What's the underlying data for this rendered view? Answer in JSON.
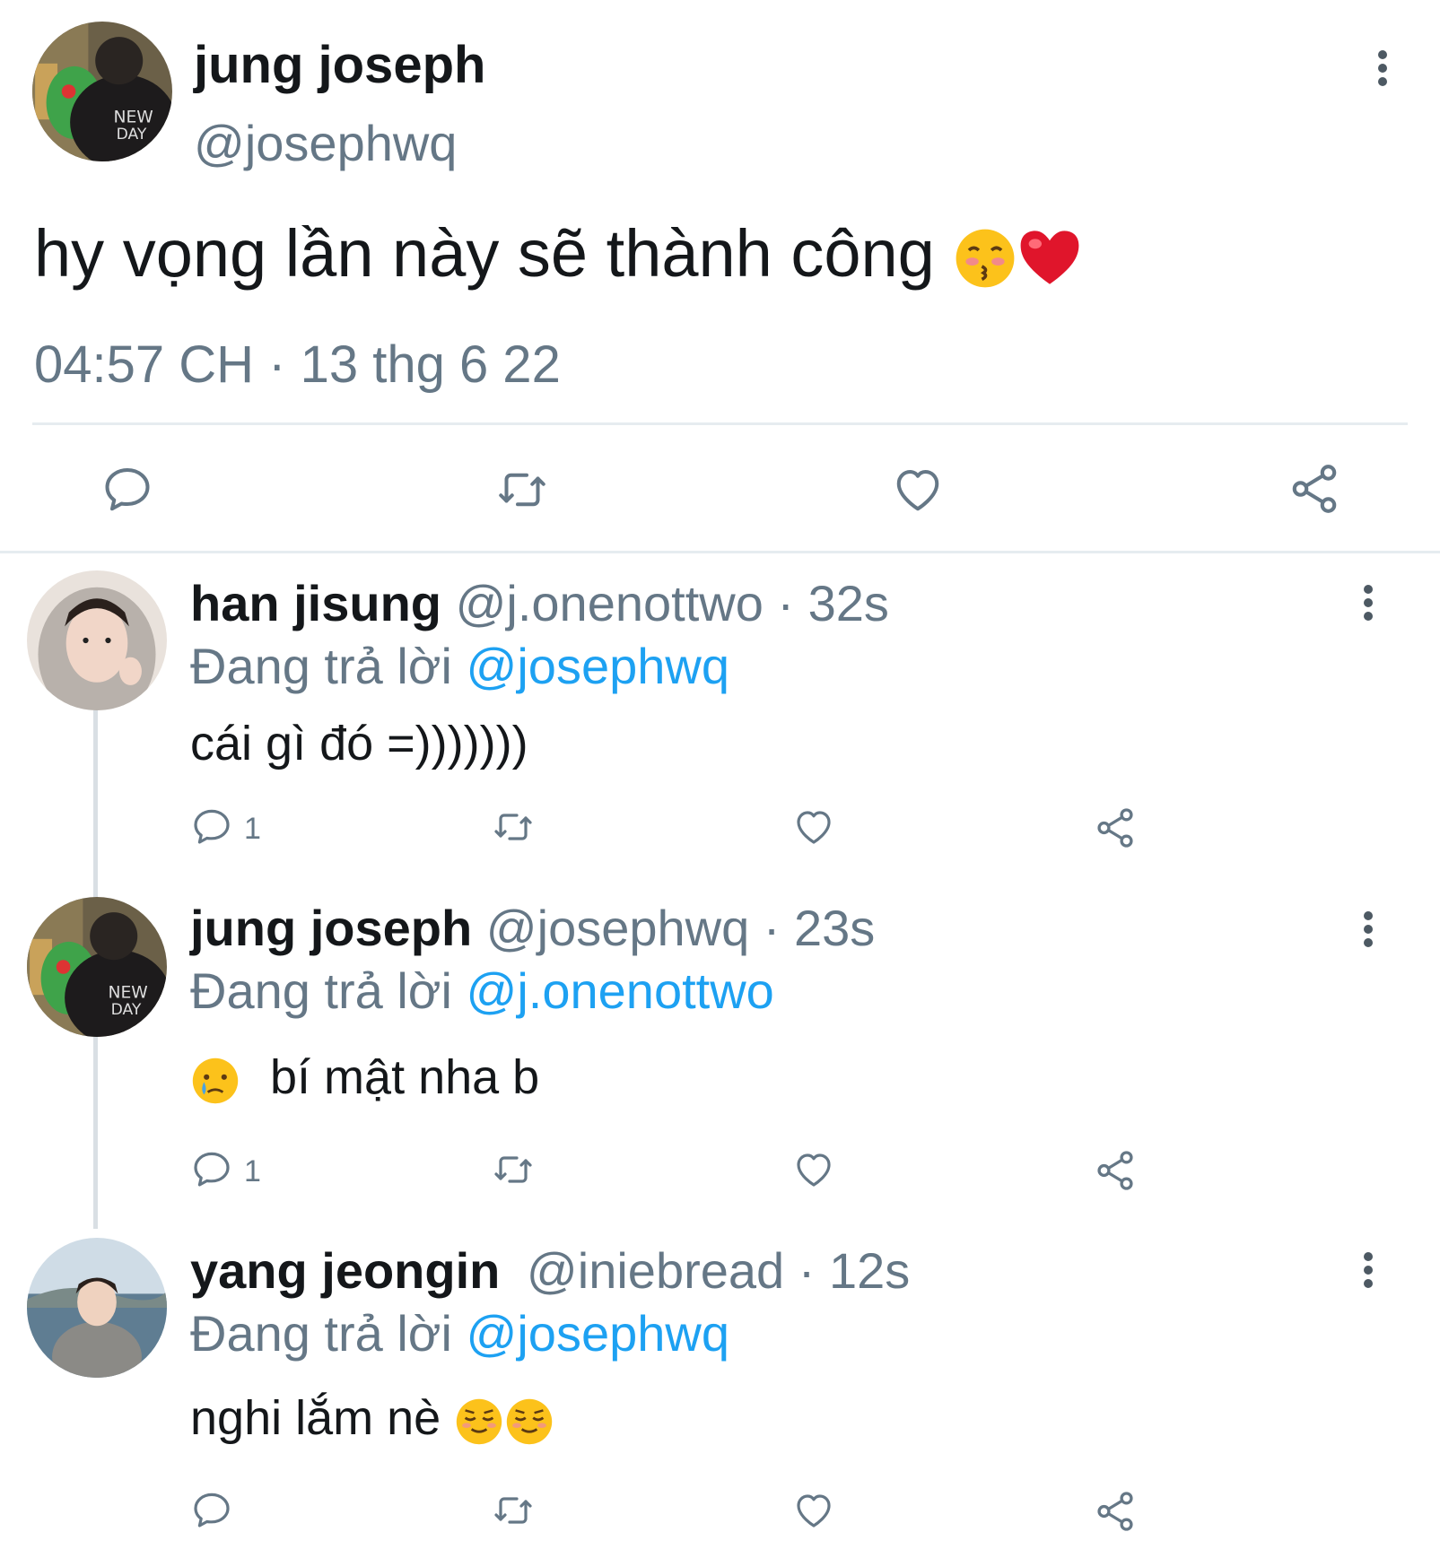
{
  "tweet": {
    "author_name": "jung joseph",
    "author_handle": "@josephwq",
    "text": "hy vọng lần này sẽ thành công",
    "emojis": [
      "kissing-closed-eyes-emoji",
      "red-heart-emoji"
    ],
    "timestamp": "04:57 CH · 13 thg 6 22",
    "actions": [
      "reply-icon",
      "retweet-icon",
      "like-icon",
      "share-icon"
    ]
  },
  "replies": [
    {
      "name": "han jisung",
      "handle": "@j.onenottwo",
      "time": "· 32s",
      "replying_prefix": "Đang trả lời",
      "replying_to": "@j.onenottwo",
      "replying_mention": "@josephwq",
      "text": "cái gì đó =)))))))",
      "reply_count": "1"
    },
    {
      "name": "jung joseph",
      "handle": "@josephwq",
      "time": "· 23s",
      "replying_prefix": "Đang trả lời",
      "replying_mention": "@j.onenottwo",
      "text": "bí mật nha b",
      "emojis": [
        "crying-face-emoji"
      ],
      "reply_count": "1"
    },
    {
      "name": "yang jeongin",
      "handle": "@iniebread",
      "time": "· 12s",
      "replying_prefix": "Đang trả lời",
      "replying_mention": "@josephwq",
      "text": "nghi lắm nè",
      "emojis": [
        "relieved-face-emoji",
        "relieved-face-emoji"
      ],
      "reply_count": ""
    }
  ],
  "colors": {
    "text": "#14171a",
    "secondary": "#657786",
    "link": "#1da1f2",
    "divider": "#e6ecf0",
    "icon": "#657786"
  }
}
